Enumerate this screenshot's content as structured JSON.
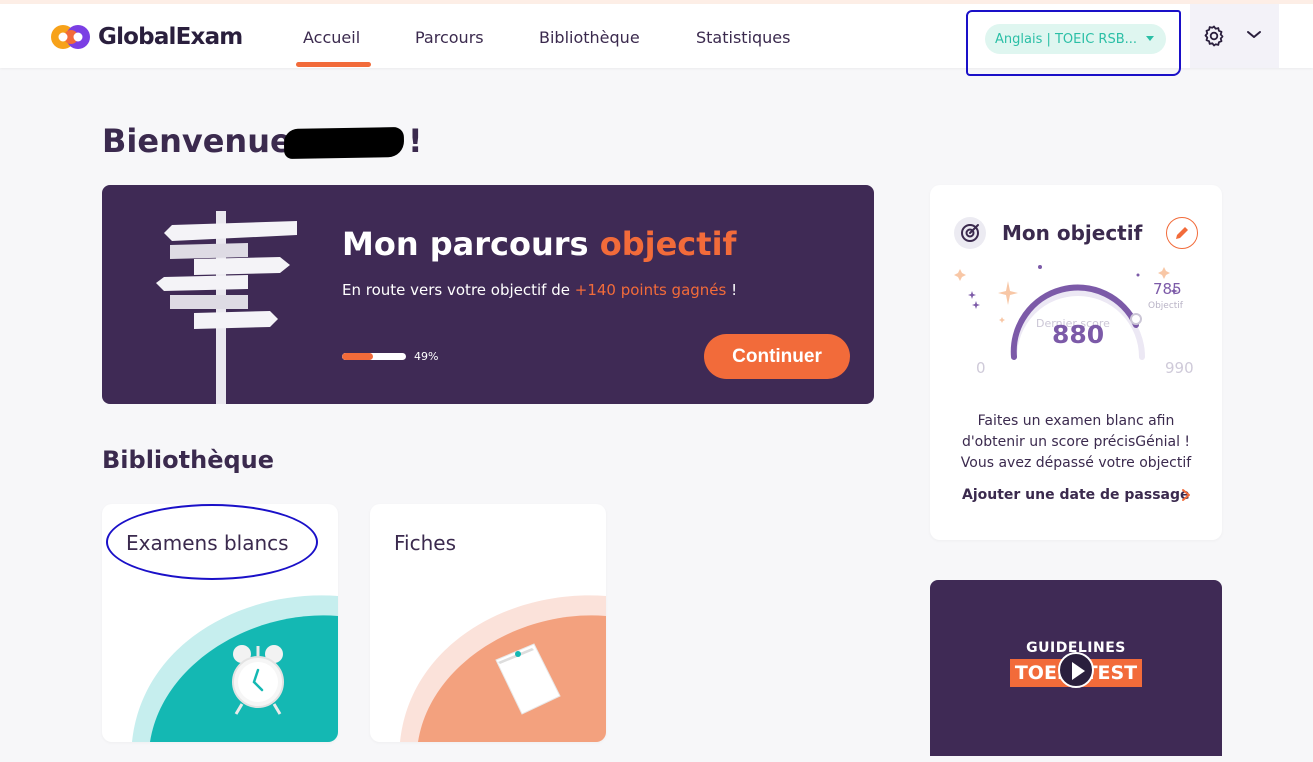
{
  "brand": {
    "name": "GlobalExam"
  },
  "nav": {
    "items": [
      {
        "label": "Accueil",
        "active": true
      },
      {
        "label": "Parcours"
      },
      {
        "label": "Bibliothèque"
      },
      {
        "label": "Statistiques"
      }
    ]
  },
  "exam_selector": {
    "value": "Anglais | TOEIC RSB..."
  },
  "colors": {
    "accent": "#f26b3a",
    "primary_dark": "#3f2a55",
    "teal": "#2bbfa6"
  },
  "welcome": {
    "greeting": "Bienvenue",
    "exclamation": "!"
  },
  "hero": {
    "title_prefix": "Mon parcours",
    "title_accent": "objectif",
    "subtitle_prefix": "En route vers votre objectif de",
    "subtitle_accent": "+140 points gagnés",
    "subtitle_suffix": "!",
    "progress_percent": 49,
    "progress_label": "49%",
    "button_label": "Continuer"
  },
  "library": {
    "title": "Bibliothèque",
    "cards": [
      {
        "label": "Examens blancs",
        "icon": "alarm-clock-icon"
      },
      {
        "label": "Fiches",
        "icon": "note-paper-icon"
      }
    ]
  },
  "goal": {
    "title": "Mon objectif",
    "gauge_min": "0",
    "gauge_max": "990",
    "score_label": "Dernier score",
    "score": "880",
    "objective_value": "785",
    "objective_label": "Objectif",
    "message": "Faites un examen blanc afin d'obtenir un score précisGénial ! Vous avez dépassé votre objectif",
    "link_label": "Ajouter une date de passage"
  },
  "video": {
    "top_text": "GUIDELINES",
    "banner_text": "TOEIC TEST"
  }
}
